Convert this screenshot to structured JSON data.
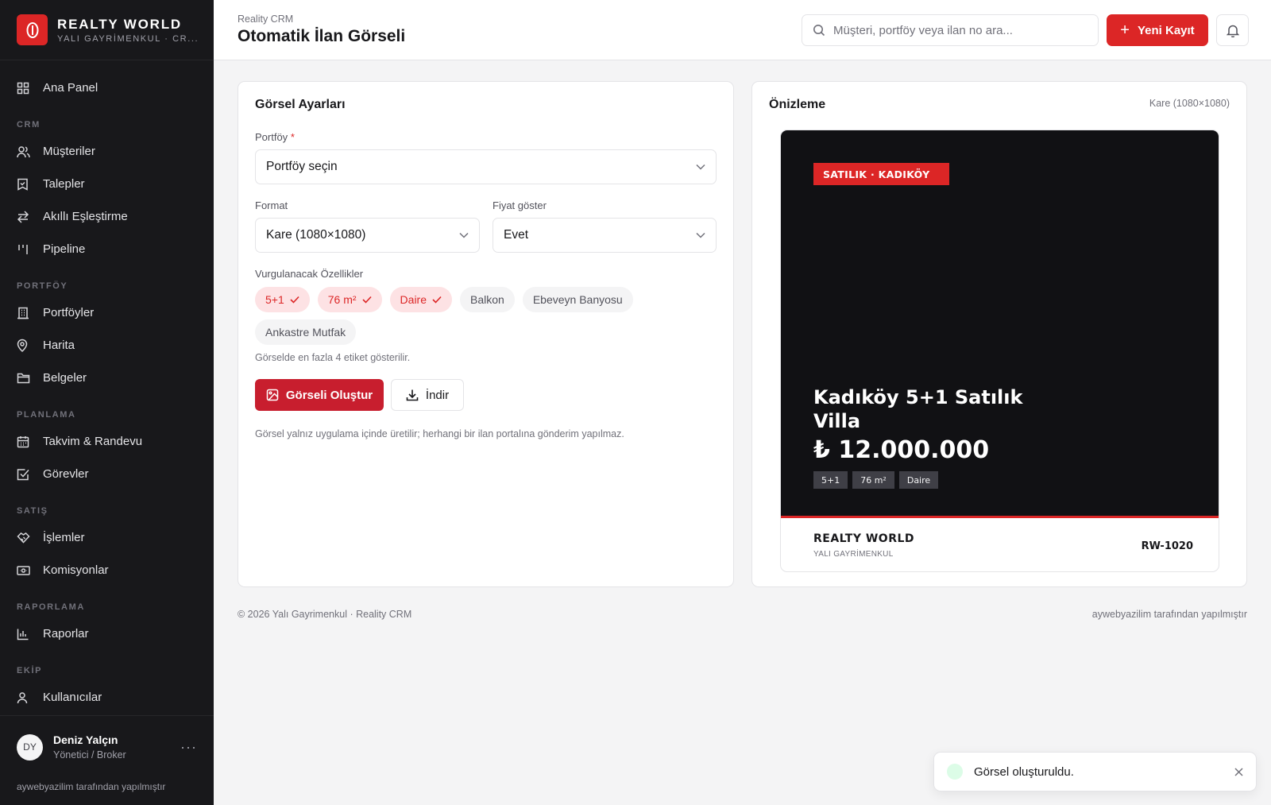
{
  "brand": {
    "name": "REALTY WORLD",
    "subtitle": "YALI GAYRİMENKUL · CR..."
  },
  "nav": {
    "main": {
      "label": "Ana Panel",
      "icon": "dashboard-icon"
    },
    "sections": [
      {
        "title": "CRM",
        "items": [
          {
            "label": "Müşteriler",
            "icon": "users-icon"
          },
          {
            "label": "Talepler",
            "icon": "request-icon"
          },
          {
            "label": "Akıllı Eşleştirme",
            "icon": "match-icon"
          },
          {
            "label": "Pipeline",
            "icon": "pipeline-icon"
          }
        ]
      },
      {
        "title": "PORTFÖY",
        "items": [
          {
            "label": "Portföyler",
            "icon": "building-icon"
          },
          {
            "label": "Harita",
            "icon": "map-pin-icon"
          },
          {
            "label": "Belgeler",
            "icon": "folder-icon"
          }
        ]
      },
      {
        "title": "PLANLAMA",
        "items": [
          {
            "label": "Takvim & Randevu",
            "icon": "calendar-icon"
          },
          {
            "label": "Görevler",
            "icon": "checkbox-icon"
          }
        ]
      },
      {
        "title": "SATIŞ",
        "items": [
          {
            "label": "İşlemler",
            "icon": "handshake-icon"
          },
          {
            "label": "Komisyonlar",
            "icon": "money-icon"
          }
        ]
      },
      {
        "title": "RAPORLAMA",
        "items": [
          {
            "label": "Raporlar",
            "icon": "chart-icon"
          }
        ]
      },
      {
        "title": "EKİP",
        "items": [
          {
            "label": "Kullanıcılar",
            "icon": "user-icon"
          }
        ]
      }
    ]
  },
  "user": {
    "initials": "DY",
    "name": "Deniz Yalçın",
    "role": "Yönetici / Broker",
    "more": "···"
  },
  "sidebar_credit": "aywebyazilim tarafından yapılmıştır",
  "header": {
    "breadcrumb": "Reality CRM",
    "title": "Otomatik İlan Görseli",
    "search_placeholder": "Müşteri, portföy veya ilan no ara...",
    "new_button": "Yeni Kayıt"
  },
  "settings": {
    "title": "Görsel Ayarları",
    "portfolio_label": "Portföy",
    "portfolio_required": "*",
    "portfolio_value": "Portföy seçin",
    "format_label": "Format",
    "format_value": "Kare (1080×1080)",
    "price_label": "Fiyat göster",
    "price_value": "Evet",
    "features_label": "Vurgulanacak Özellikler",
    "chips": [
      {
        "label": "5+1",
        "selected": true
      },
      {
        "label": "76 m²",
        "selected": true
      },
      {
        "label": "Daire",
        "selected": true
      },
      {
        "label": "Balkon",
        "selected": false
      },
      {
        "label": "Ebeveyn Banyosu",
        "selected": false
      },
      {
        "label": "Ankastre Mutfak",
        "selected": false
      }
    ],
    "chips_hint": "Görselde en fazla 4 etiket gösterilir.",
    "generate_button": "Görseli Oluştur",
    "download_button": "İndir",
    "note": "Görsel yalnız uygulama içinde üretilir; herhangi bir ilan portalına gönderim yapılmaz."
  },
  "preview": {
    "title": "Önizleme",
    "size": "Kare (1080×1080)",
    "badge": "SATILIK · KADIKÖY",
    "listing_title": "Kadıköy 5+1 Satılık Villa",
    "price": "₺ 12.000.000",
    "tags": [
      "5+1",
      "76 m²",
      "Daire"
    ],
    "brand": "REALTY WORLD",
    "brand_sub": "YALI GAYRİMENKUL",
    "ref": "RW-1020"
  },
  "footer": {
    "copyright": "© 2026 Yalı Gayrimenkul · Reality CRM",
    "credit": "aywebyazilim tarafından yapılmıştır"
  },
  "toast": {
    "message": "Görsel oluşturuldu."
  },
  "colors": {
    "accent": "#dc2626",
    "sidebar": "#18181b",
    "chip_selected_bg": "#fde2e4"
  }
}
